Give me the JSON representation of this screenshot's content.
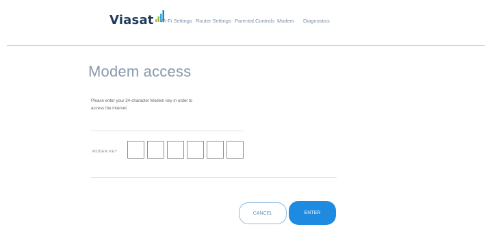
{
  "header": {
    "logo_text": "Viasat",
    "brand_color": "#1f3a5b",
    "nav": [
      {
        "label": "Wi-Fi Settings"
      },
      {
        "label": "Router Settings"
      },
      {
        "label": "Parental Controls"
      },
      {
        "label": "Modem"
      },
      {
        "label": "Diagnostics"
      }
    ]
  },
  "main": {
    "title": "Modem access",
    "instruction": "Please enter your 24-character Modem key in order to access the internet.",
    "modem_key_label": "MODEM KEY",
    "key_boxes": [
      "",
      "",
      "",
      "",
      "",
      ""
    ]
  },
  "actions": {
    "cancel_label": "CANCEL",
    "enter_label": "ENTER",
    "accent_color": "#1e8be0"
  }
}
